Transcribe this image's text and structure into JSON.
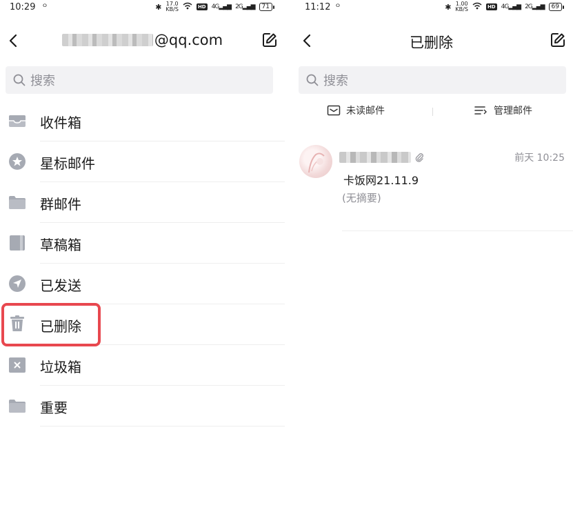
{
  "left": {
    "status": {
      "time": "10:29",
      "speed_top": "17.0",
      "speed_bottom": "KB/S",
      "hd": "HD",
      "sig1": "4G",
      "sig2": "2G",
      "battery": "71"
    },
    "header": {
      "account_suffix": "@qq.com"
    },
    "search": {
      "placeholder": "搜索"
    },
    "folders": [
      {
        "label": "收件箱",
        "icon": "inbox-icon"
      },
      {
        "label": "星标邮件",
        "icon": "star-icon"
      },
      {
        "label": "群邮件",
        "icon": "folder-icon"
      },
      {
        "label": "草稿箱",
        "icon": "draft-icon"
      },
      {
        "label": "已发送",
        "icon": "sent-icon"
      },
      {
        "label": "已删除",
        "icon": "trash-icon"
      },
      {
        "label": "垃圾箱",
        "icon": "spam-icon"
      },
      {
        "label": "重要",
        "icon": "folder-icon"
      }
    ],
    "highlight_color": "#e8484f"
  },
  "right": {
    "status": {
      "time": "11:12",
      "speed_top": "1.00",
      "speed_bottom": "KB/S",
      "hd": "HD",
      "sig1": "4G",
      "sig2": "2G",
      "battery": "69"
    },
    "header": {
      "title": "已删除"
    },
    "search": {
      "placeholder": "搜索"
    },
    "actions": {
      "unread": "未读邮件",
      "manage": "管理邮件"
    },
    "mail": {
      "time": "前天 10:25",
      "subject": "卡饭网21.11.9",
      "summary": "(无摘要)"
    }
  }
}
